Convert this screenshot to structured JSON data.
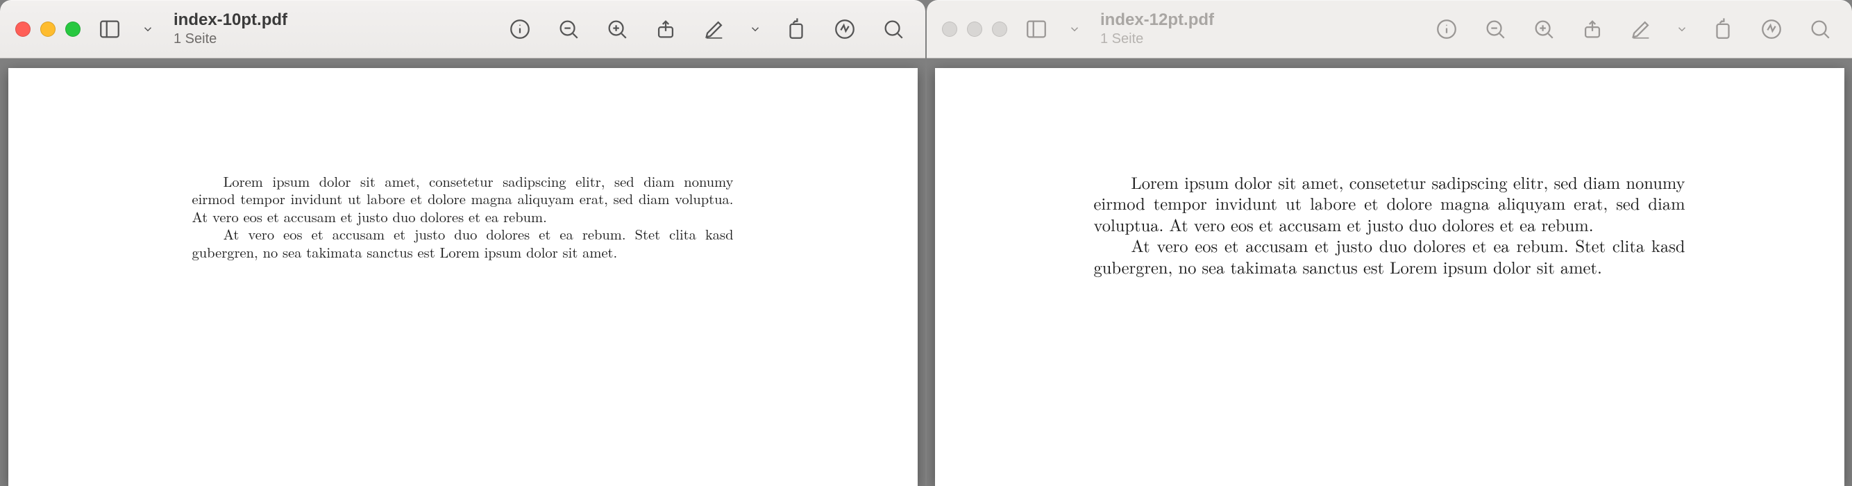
{
  "windows": [
    {
      "title": "index-10pt.pdf",
      "subtitle": "1 Seite",
      "paragraphs": [
        "Lorem ipsum dolor sit amet, consetetur sadipscing elitr, sed diam nonumy eirmod tempor invidunt ut labore et dolore magna aliquyam erat, sed diam voluptua. At vero eos et accusam et justo duo dolores et ea rebum.",
        "At vero eos et accusam et justo duo dolores et ea rebum. Stet clita kasd gubergren, no sea takimata sanctus est Lorem ipsum dolor sit amet."
      ]
    },
    {
      "title": "index-12pt.pdf",
      "subtitle": "1 Seite",
      "paragraphs": [
        "Lorem ipsum dolor sit amet, consetetur sadipscing elitr, sed diam nonumy eirmod tempor invidunt ut labore et dolore magna aliquyam erat, sed diam voluptua. At vero eos et accusam et justo duo dolores et ea rebum.",
        "At vero eos et accusam et justo duo dolores et ea rebum. Stet clita kasd gubergren, no sea takimata sanctus est Lorem ipsum dolor sit amet."
      ]
    }
  ],
  "icons": {
    "sidebar": "sidebar-icon",
    "info": "info-icon",
    "zoom_out": "zoom-out-icon",
    "zoom_in": "zoom-in-icon",
    "share": "share-icon",
    "markup": "pencil-icon",
    "rotate": "rotate-icon",
    "highlight": "highlight-icon",
    "search": "search-icon"
  }
}
